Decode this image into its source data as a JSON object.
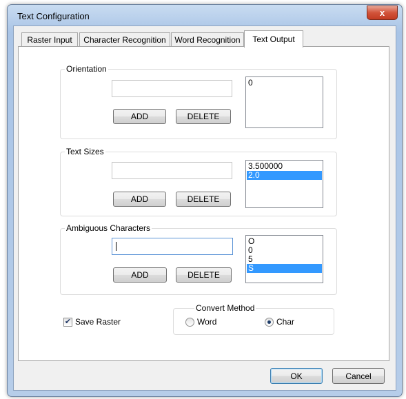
{
  "window": {
    "title": "Text Configuration",
    "close_symbol": "x"
  },
  "tabs": [
    {
      "label": "Raster Input"
    },
    {
      "label": "Character Recognition"
    },
    {
      "label": "Word Recognition"
    },
    {
      "label": "Text Output",
      "active": true
    }
  ],
  "orientation": {
    "legend": "Orientation",
    "input_value": "",
    "add_label": "ADD",
    "delete_label": "DELETE",
    "items": [
      "0"
    ],
    "selected_index": -1
  },
  "text_sizes": {
    "legend": "Text Sizes",
    "input_value": "",
    "add_label": "ADD",
    "delete_label": "DELETE",
    "items": [
      "3.500000",
      "2.0"
    ],
    "selected_index": 1
  },
  "ambiguous_characters": {
    "legend": "Ambiguous Characters",
    "input_value": "",
    "add_label": "ADD",
    "delete_label": "DELETE",
    "items": [
      "O",
      "0",
      "5",
      "S"
    ],
    "selected_index": 3
  },
  "save_raster": {
    "label": "Save Raster",
    "checked": true,
    "check_glyph": "✔"
  },
  "convert_method": {
    "legend": "Convert Method",
    "options": [
      {
        "label": "Word",
        "selected": false
      },
      {
        "label": "Char",
        "selected": true
      }
    ]
  },
  "footer": {
    "ok_label": "OK",
    "cancel_label": "Cancel"
  },
  "colors": {
    "selection": "#3399ff",
    "close_button": "#c94a31"
  }
}
